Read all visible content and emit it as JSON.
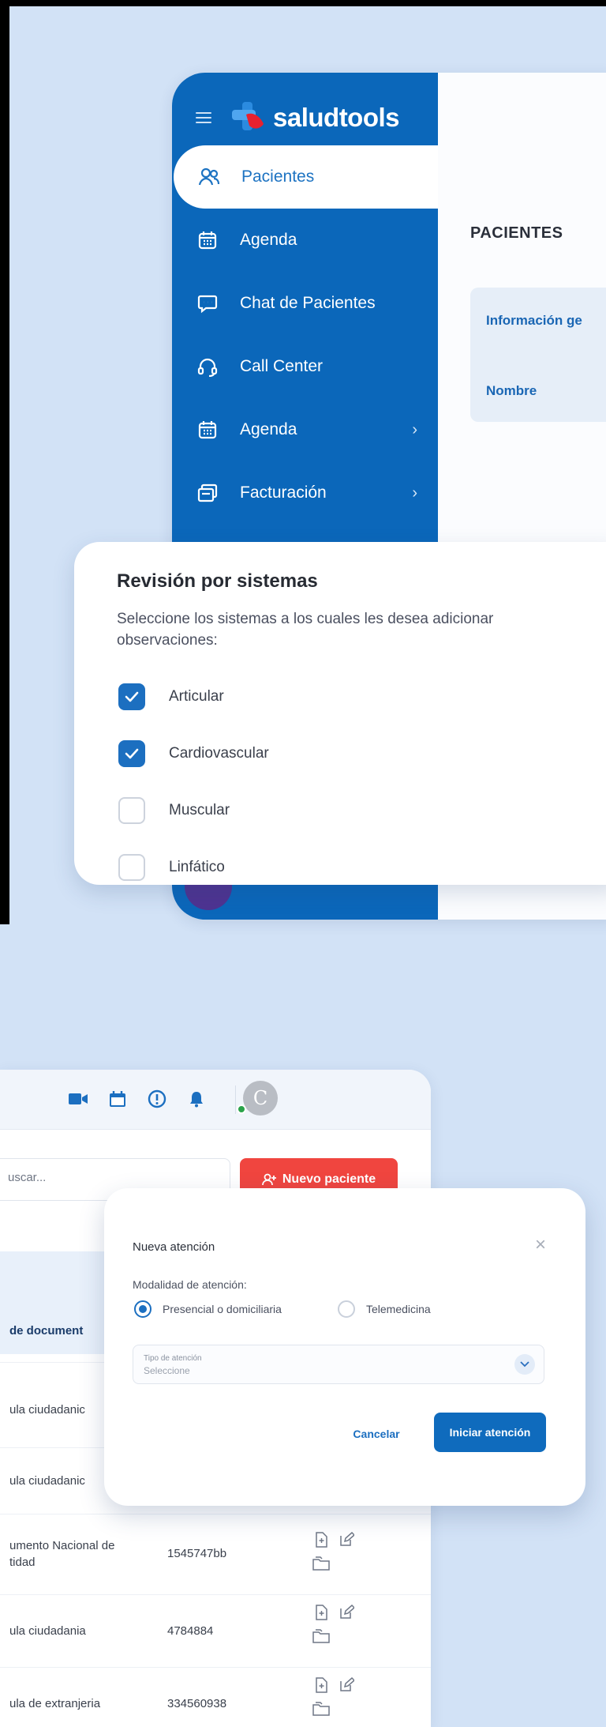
{
  "brand": {
    "name": "saludtools",
    "logo_icon": "saludtools-cross-logo"
  },
  "sidebar": {
    "items": [
      {
        "label": "Pacientes",
        "icon": "users-icon",
        "active": true,
        "has_submenu": false
      },
      {
        "label": "Agenda",
        "icon": "calendar-icon",
        "active": false,
        "has_submenu": false
      },
      {
        "label": "Chat de Pacientes",
        "icon": "chat-icon",
        "active": false,
        "has_submenu": false
      },
      {
        "label": "Call Center",
        "icon": "headset-icon",
        "active": false,
        "has_submenu": false
      },
      {
        "label": "Agenda",
        "icon": "calendar-icon",
        "active": false,
        "has_submenu": true
      },
      {
        "label": "Facturación",
        "icon": "invoice-icon",
        "active": false,
        "has_submenu": true
      }
    ],
    "chevron": "›"
  },
  "main": {
    "title": "PACIENTES",
    "tab_info": "Información ge",
    "tab_name": "Nombre"
  },
  "revision": {
    "title": "Revisión por sistemas",
    "subtitle": "Seleccione los sistemas a los cuales les desea adicionar observaciones:",
    "options": [
      {
        "label": "Articular",
        "checked": true
      },
      {
        "label": "Cardiovascular",
        "checked": true
      },
      {
        "label": "Muscular",
        "checked": false
      },
      {
        "label": "Linfático",
        "checked": false
      }
    ]
  },
  "topbar": {
    "icons": [
      "video-icon",
      "calendar-icon",
      "alert-icon",
      "bell-icon"
    ],
    "avatar_initial": "C",
    "status_color": "#2aa34a"
  },
  "search": {
    "placeholder": "uscar..."
  },
  "new_patient": {
    "label": "Nuevo paciente",
    "icon": "add-user-icon",
    "color": "#f0453f"
  },
  "table": {
    "header_col": "de document",
    "rows": [
      {
        "doc_type": "ula ciudadanic",
        "doc_number": ""
      },
      {
        "doc_type": "ula ciudadanic",
        "doc_number": ""
      },
      {
        "doc_type": "umento Nacional de\ntidad",
        "doc_number": "1545747bb"
      },
      {
        "doc_type": "ula ciudadania",
        "doc_number": "4784884"
      },
      {
        "doc_type": "ula de extranjeria",
        "doc_number": "334560938"
      }
    ]
  },
  "dialog": {
    "title": "Nueva atención",
    "close": "×",
    "modality_label": "Modalidad de atención:",
    "options": [
      {
        "label": "Presencial o domiciliaria",
        "selected": true
      },
      {
        "label": "Telemedicina",
        "selected": false
      }
    ],
    "type_label": "Tipo de atención",
    "type_placeholder": "Seleccione",
    "cancel": "Cancelar",
    "start": "Iniciar atención"
  },
  "colors": {
    "primary": "#0b67ba",
    "accent_red": "#f0453f",
    "background": "#d2e2f6"
  }
}
